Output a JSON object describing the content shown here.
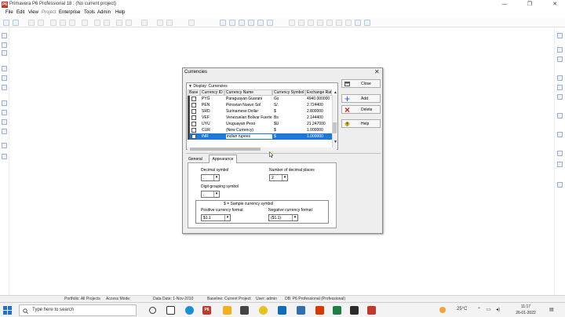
{
  "window": {
    "app_badge": "P6",
    "title": "Primavera P6 Professional 18 : (No current project)",
    "minimize": "—",
    "maximize": "❐",
    "close": "✕"
  },
  "menu": [
    "File",
    "Edit",
    "View",
    "Project",
    "Enterprise",
    "Tools",
    "Admin",
    "Help"
  ],
  "dialog": {
    "title": "Currencies",
    "close": "✕",
    "grid_caption": "Display: Currencies",
    "columns": [
      "Base",
      "Currency ID",
      "Currency Name",
      "Currency Symbol",
      "Exchange Rate"
    ],
    "rows": [
      {
        "id": "PYG",
        "name": "Paraguayan Guarani",
        "symbol": "Gs",
        "rate": "4940.000000"
      },
      {
        "id": "PEN",
        "name": "Peruvian Nuevo Sol",
        "symbol": "S/.",
        "rate": "2.724400"
      },
      {
        "id": "SRD",
        "name": "Surinamese Dollar",
        "symbol": "$",
        "rate": "2.800000"
      },
      {
        "id": "VEF",
        "name": "Venezuelan Bolivar Fuerte",
        "symbol": "Bs",
        "rate": "2.144400"
      },
      {
        "id": "UYU",
        "name": "Uruguayan Peso",
        "symbol": "$U",
        "rate": "21.247000"
      },
      {
        "id": "CUR",
        "name": "(New Currency)",
        "symbol": "$",
        "rate": "1.000000"
      },
      {
        "id": "INR",
        "name": "indian rupees",
        "symbol": "$",
        "rate": "1.000000"
      }
    ],
    "buttons": {
      "close": "Close",
      "add": "Add",
      "delete": "Delete",
      "help": "Help"
    },
    "tabs": [
      "General",
      "Appearance"
    ],
    "appearance": {
      "decimal_symbol_label": "Decimal symbol",
      "decimal_symbol_value": ".",
      "decimal_places_label": "Number of decimal places",
      "decimal_places_value": "2",
      "digit_grouping_label": "Digit grouping symbol",
      "digit_grouping_value": ",",
      "sample_caption": "$ = Sample currency symbol",
      "positive_format_label": "Positive currency format",
      "positive_format_value": "$1.1",
      "negative_format_label": "Negative currency format",
      "negative_format_value": "($1.1)"
    }
  },
  "status": {
    "portfolio": "Portfolio: All Projects",
    "access_mode": "Access Mode:",
    "data_date": "Data Date: 1-Nov-2010",
    "baseline": "Baseline: Current Project",
    "user": "User: admin",
    "db": "DB: P6 Professional (Professional)"
  },
  "taskbar": {
    "search_placeholder": "Type here to search",
    "weather": "25°C",
    "time": "11:17",
    "date": "26-01-2022",
    "pinned_p6": "P6"
  },
  "colors": {
    "selection": "#1e78d6",
    "p6_red": "#c0392b"
  }
}
